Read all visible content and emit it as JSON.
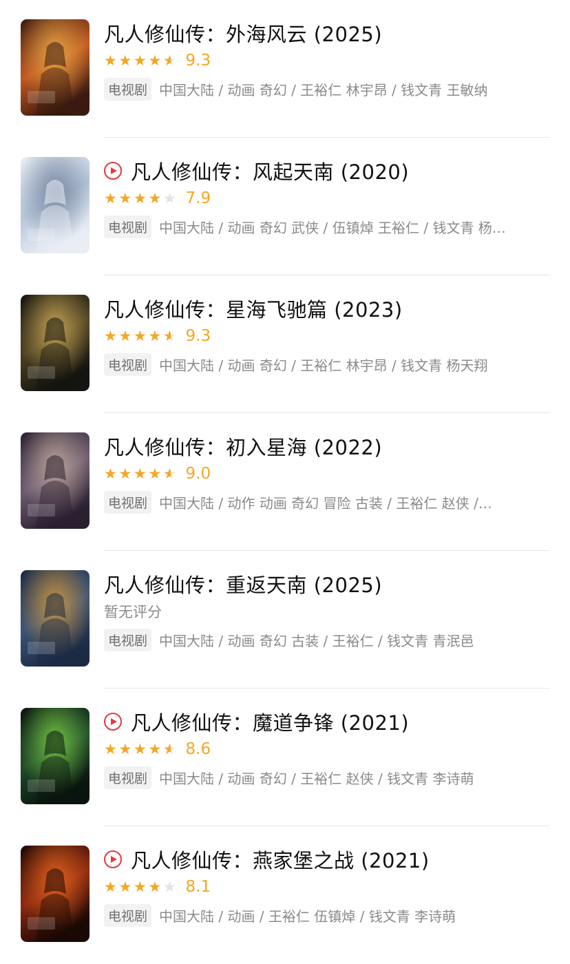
{
  "results": [
    {
      "title": "凡人修仙传：外海风云",
      "year": "(2025)",
      "playable": false,
      "rating_stars": 4.5,
      "score": "9.3",
      "type_badge": "电视剧",
      "meta": "中国大陆 / 动画 奇幻 / 王裕仁 林宇昂 / 钱文青 王敏纳",
      "poster_colors": [
        "#3a1a10",
        "#c0561f",
        "#f0b04a"
      ]
    },
    {
      "title": "凡人修仙传：风起天南",
      "year": "(2020)",
      "playable": true,
      "rating_stars": 4,
      "score": "7.9",
      "type_badge": "电视剧",
      "meta": "中国大陆 / 动画 奇幻 武侠 / 伍镇焯 王裕仁 / 钱文青 杨…",
      "poster_colors": [
        "#e9eef5",
        "#b8c6da",
        "#6d7e99"
      ]
    },
    {
      "title": "凡人修仙传：星海飞驰篇",
      "year": "(2023)",
      "playable": false,
      "rating_stars": 4.5,
      "score": "9.3",
      "type_badge": "电视剧",
      "meta": "中国大陆 / 动画 奇幻 / 王裕仁 林宇昂 / 钱文青 杨天翔",
      "poster_colors": [
        "#141410",
        "#4a3f22",
        "#d8b45a"
      ]
    },
    {
      "title": "凡人修仙传：初入星海",
      "year": "(2022)",
      "playable": false,
      "rating_stars": 4.5,
      "score": "9.0",
      "type_badge": "电视剧",
      "meta": "中国大陆 / 动作 动画 奇幻 冒险 古装 / 王裕仁 赵侠 /…",
      "poster_colors": [
        "#2a2030",
        "#6a5a70",
        "#c9b0a0"
      ]
    },
    {
      "title": "凡人修仙传：重返天南",
      "year": "(2025)",
      "playable": false,
      "rating_stars": null,
      "score": "",
      "no_rating": "暂无评分",
      "type_badge": "电视剧",
      "meta": "中国大陆 / 动画 奇幻 古装 / 王裕仁 / 钱文青 青泯邑",
      "poster_colors": [
        "#1c2a44",
        "#3a5478",
        "#e0a03a"
      ]
    },
    {
      "title": "凡人修仙传：魔道争锋",
      "year": "(2021)",
      "playable": true,
      "rating_stars": 4.5,
      "score": "8.6",
      "type_badge": "电视剧",
      "meta": "中国大陆 / 动画 奇幻 / 王裕仁 赵侠 / 钱文青 李诗萌",
      "poster_colors": [
        "#0a140e",
        "#1f4a2a",
        "#7fd64a"
      ]
    },
    {
      "title": "凡人修仙传：燕家堡之战",
      "year": "(2021)",
      "playable": true,
      "rating_stars": 4,
      "score": "8.1",
      "type_badge": "电视剧",
      "meta": "中国大陆 / 动画 / 王裕仁 伍镇焯 / 钱文青 李诗萌",
      "poster_colors": [
        "#1a0804",
        "#8a2810",
        "#f06a20"
      ]
    }
  ]
}
